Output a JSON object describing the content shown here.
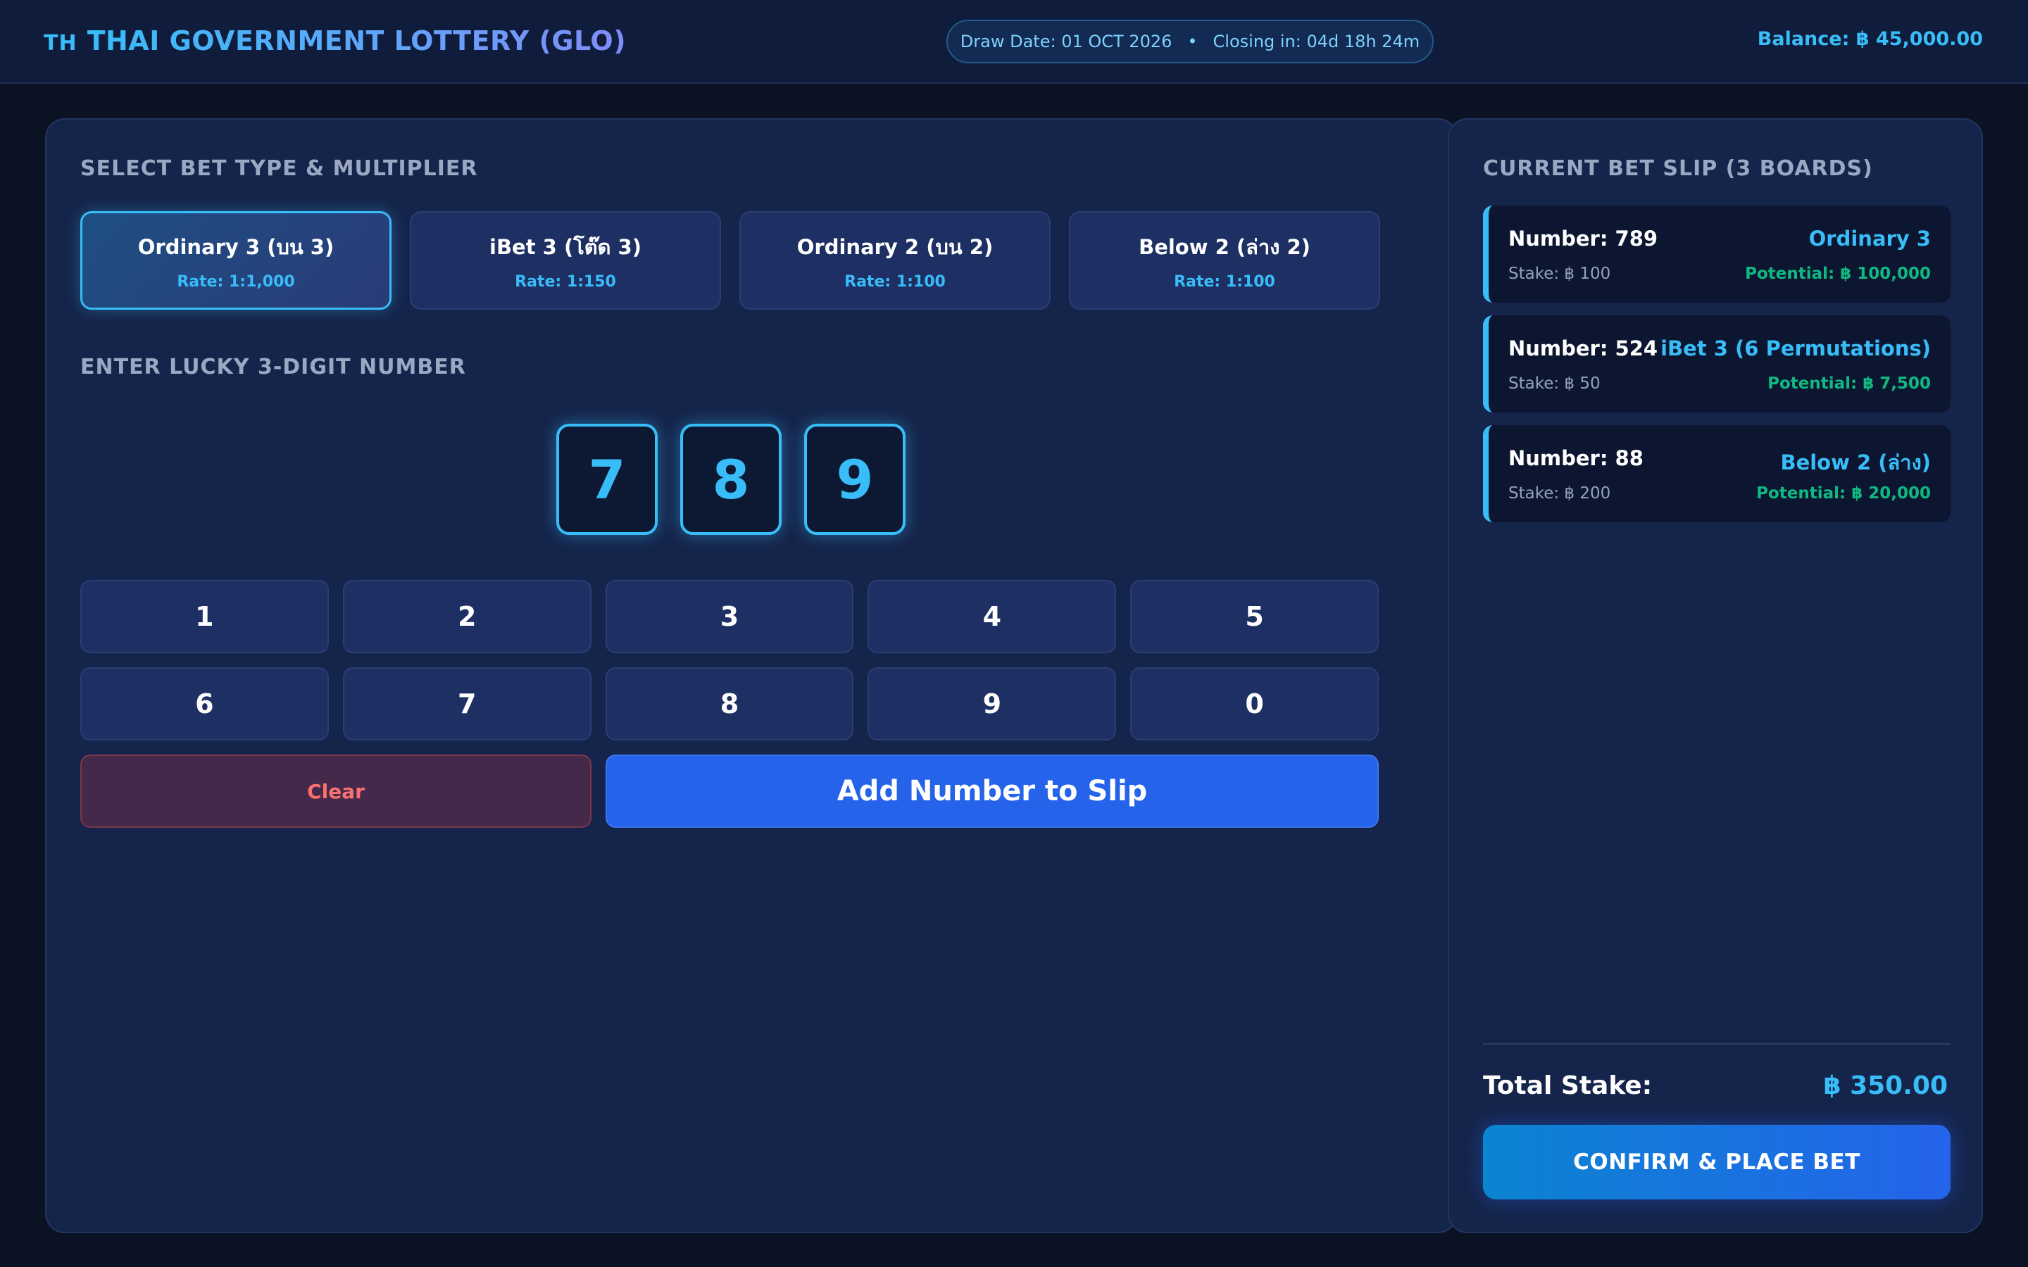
{
  "header": {
    "flag": "TH",
    "title": "THAI GOVERNMENT LOTTERY (GLO)",
    "draw_date": "Draw Date: 01 OCT 2026",
    "separator": "•",
    "closing": "Closing in: 04d 18h 24m",
    "balance": "Balance: ฿ 45,000.00"
  },
  "bet_section": {
    "title": "SELECT BET TYPE & MULTIPLIER",
    "types": [
      {
        "name": "Ordinary 3 (บน 3)",
        "rate": "Rate: 1:1,000",
        "active": true
      },
      {
        "name": "iBet 3 (โต๊ด 3)",
        "rate": "Rate: 1:150",
        "active": false
      },
      {
        "name": "Ordinary 2 (บน 2)",
        "rate": "Rate: 1:100",
        "active": false
      },
      {
        "name": "Below 2 (ล่าง 2)",
        "rate": "Rate: 1:100",
        "active": false
      }
    ]
  },
  "number_section": {
    "title": "ENTER LUCKY 3-DIGIT NUMBER",
    "digits": [
      "7",
      "8",
      "9"
    ]
  },
  "keypad": {
    "keys": [
      "1",
      "2",
      "3",
      "4",
      "5",
      "6",
      "7",
      "8",
      "9",
      "0"
    ],
    "clear_label": "Clear",
    "add_label": "Add Number to Slip"
  },
  "slip": {
    "title": "CURRENT BET SLIP (3 BOARDS)",
    "items": [
      {
        "number": "Number: 789",
        "type": "Ordinary 3",
        "stake": "Stake: ฿ 100",
        "potential": "Potential: ฿ 100,000"
      },
      {
        "number": "Number: 524",
        "type": "iBet 3 (6 Permutations)",
        "stake": "Stake: ฿ 50",
        "potential": "Potential: ฿ 7,500"
      },
      {
        "number": "Number: 88",
        "type": "Below 2 (ล่าง)",
        "stake": "Stake: ฿ 200",
        "potential": "Potential: ฿ 20,000"
      }
    ],
    "total_label": "Total Stake:",
    "total_value": "฿ 350.00",
    "confirm_label": "CONFIRM & PLACE BET"
  },
  "colors": {
    "accent": "#38bdf8",
    "primary_button": "#2563eb",
    "potential_green": "#10b981",
    "clear_red": "#f87171",
    "panel_bg": "#15244a",
    "page_bg": "#0b1224"
  }
}
